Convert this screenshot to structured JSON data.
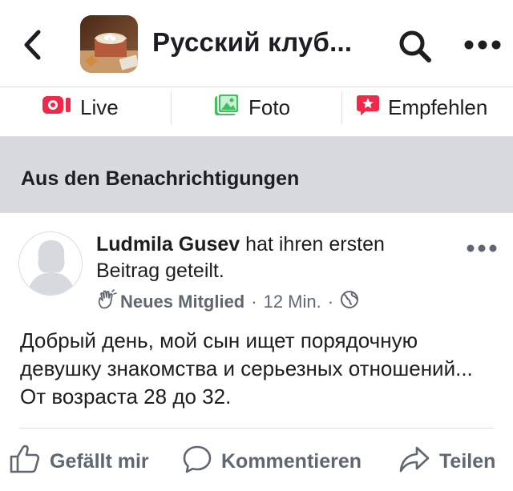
{
  "header": {
    "title": "Русский клуб...",
    "back_icon": "chevron-left-icon",
    "search_icon": "search-icon",
    "more_icon": "more-horizontal-icon"
  },
  "actions": [
    {
      "label": "Live",
      "icon": "live-video-icon",
      "color": "#f02849"
    },
    {
      "label": "Foto",
      "icon": "photo-icon",
      "color": "#45bd62"
    },
    {
      "label": "Empfehlen",
      "icon": "recommend-star-icon",
      "color": "#f02849"
    }
  ],
  "section": {
    "label": "Aus den Benachrichtigungen"
  },
  "post": {
    "author": "Ludmila Gusev",
    "action_text": " hat ihren ersten Beitrag geteilt.",
    "badge": "Neues Mitglied",
    "time": "12 Min.",
    "separator": "·",
    "body": "Добрый день, мой сын ищет порядочную девушку знакомства и серьезных отношений... От возраста 28 до 32."
  },
  "reactions": {
    "like_label": "Gefällt mir",
    "comment_label": "Kommentieren",
    "share_label": "Teilen"
  },
  "colors": {
    "text": "#1c1e21",
    "secondary_text": "#606770",
    "band": "#d8dadf",
    "divider": "#dadde1"
  }
}
